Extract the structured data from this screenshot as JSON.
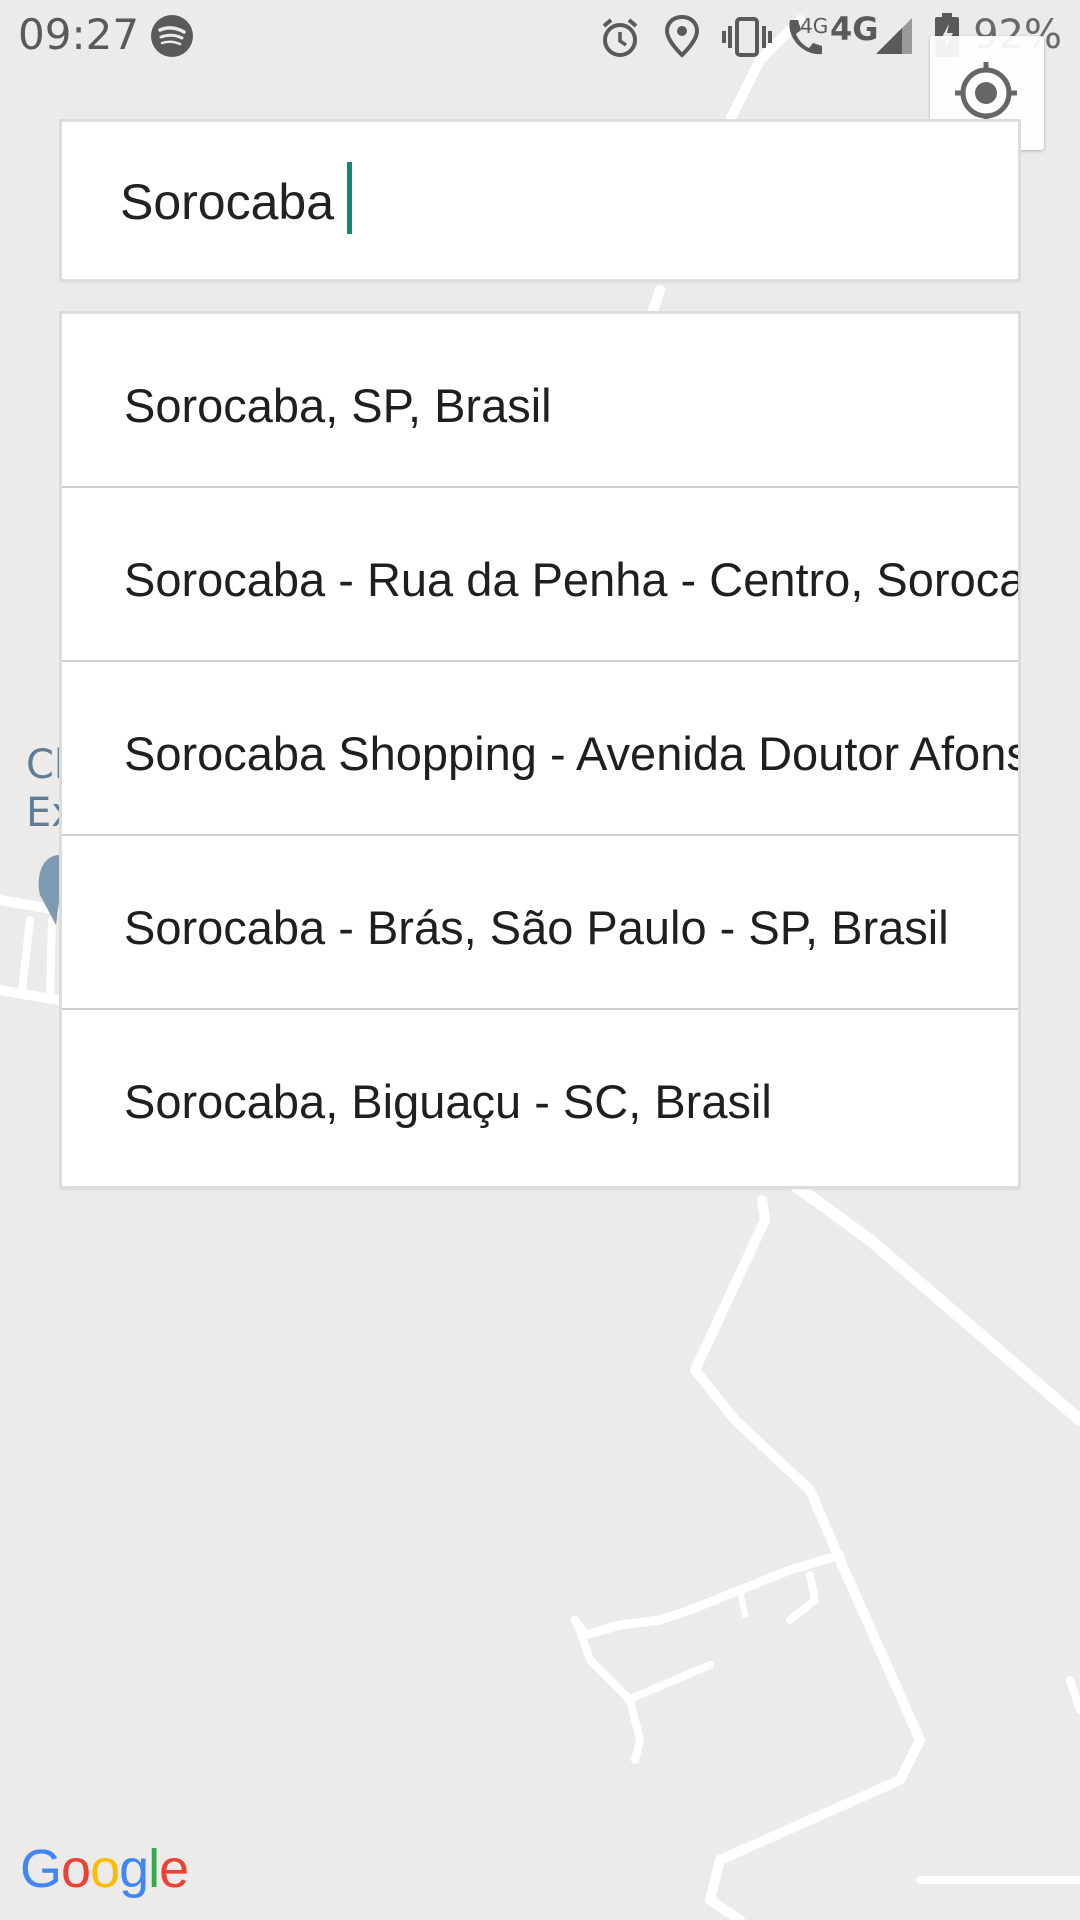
{
  "status_bar": {
    "time": "09:27",
    "battery": "92%",
    "icons": [
      "spotify-icon",
      "alarm-icon",
      "location-pin-icon",
      "vibrate-icon",
      "wifi-calling-icon",
      "4g-network-icon",
      "signal-icon",
      "battery-charging-icon"
    ],
    "network_small": "4G",
    "network": "4G"
  },
  "search": {
    "value": "Sorocaba",
    "placeholder": ""
  },
  "suggestions": [
    {
      "label": "Sorocaba, SP, Brasil"
    },
    {
      "label": "Sorocaba - Rua da Penha - Centro, Sorocaba"
    },
    {
      "label": "Sorocaba Shopping - Avenida Doutor Afonso"
    },
    {
      "label": "Sorocaba - Brás, São Paulo - SP, Brasil"
    },
    {
      "label": "Sorocaba, Biguaçu - SC, Brasil"
    }
  ],
  "map": {
    "label_line1": "Cl",
    "label_line2": "Ex"
  },
  "logo": {
    "letters": [
      "G",
      "o",
      "o",
      "g",
      "l",
      "e"
    ],
    "colors": [
      "#4285F4",
      "#EA4335",
      "#FBBC05",
      "#4285F4",
      "#34A853",
      "#EA4335"
    ]
  },
  "colors": {
    "accent": "#0e8a78",
    "map_bg": "#ecebea",
    "road": "#ffffff",
    "marker": "#7d9cb3"
  }
}
